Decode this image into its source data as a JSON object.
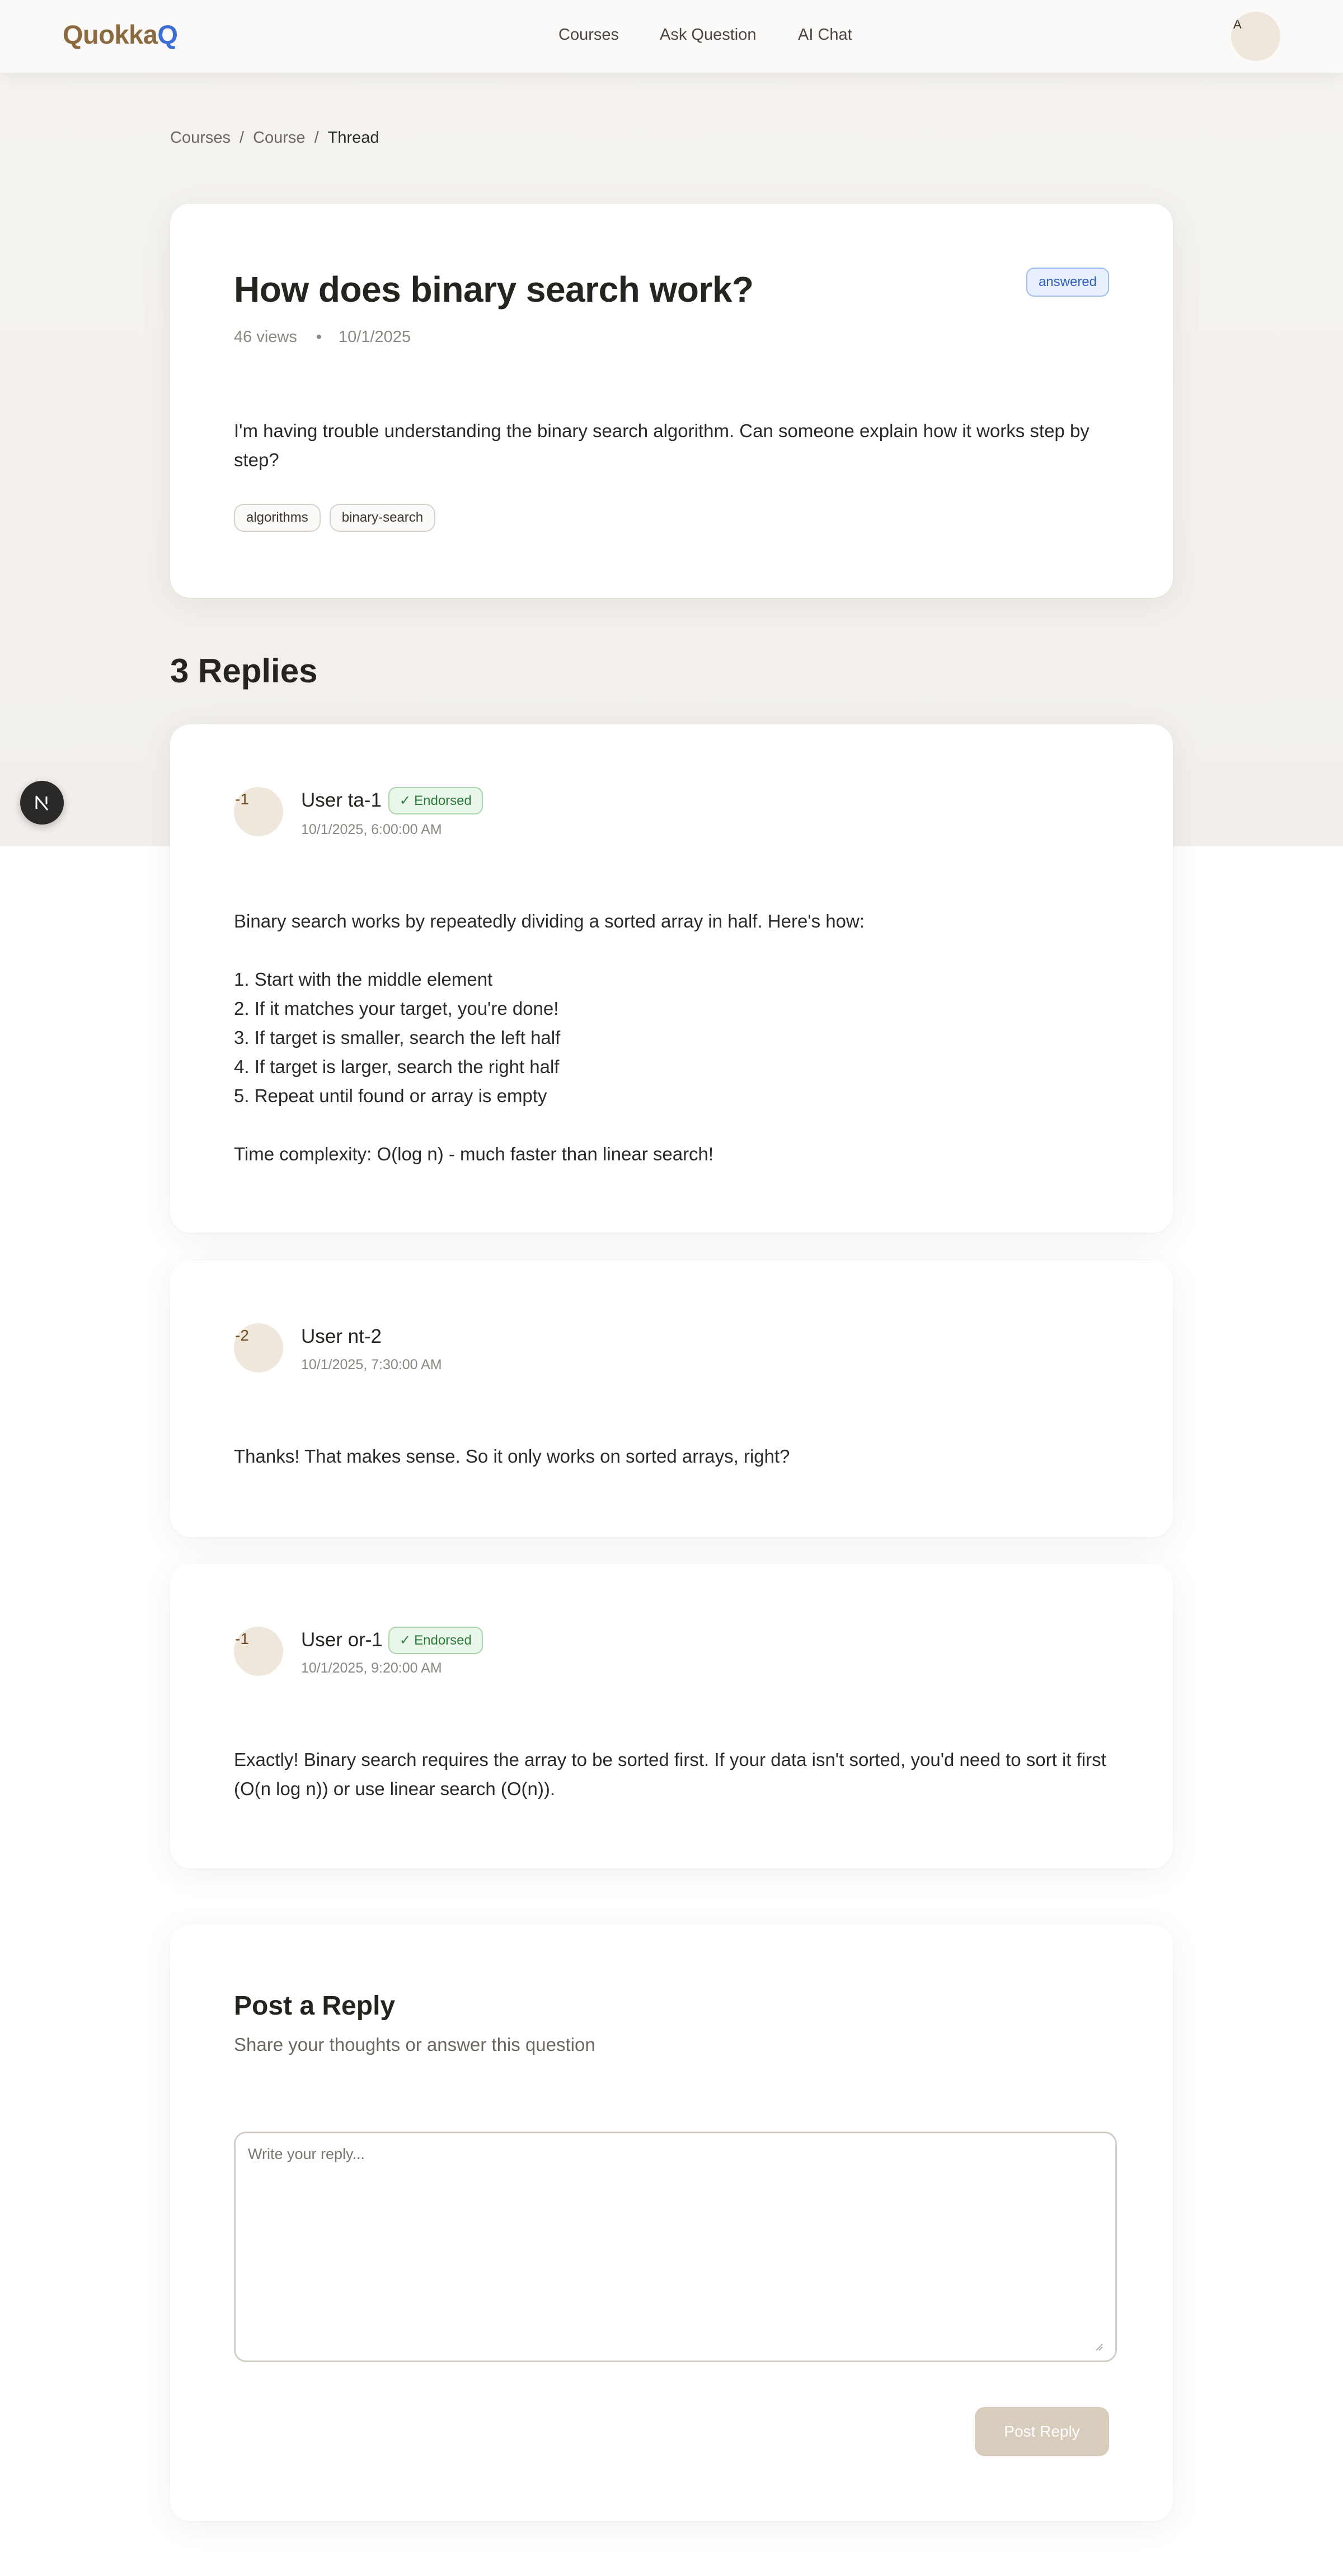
{
  "app": {
    "logo_part1": "Quokka",
    "logo_part2": "Q"
  },
  "nav": {
    "links": [
      "Courses",
      "Ask Question",
      "AI Chat"
    ],
    "avatar_initial": "A"
  },
  "breadcrumb": {
    "items": [
      "Courses",
      "Course",
      "Thread"
    ],
    "separator": "/"
  },
  "question": {
    "title": "How does binary search work?",
    "status": "answered",
    "views": "46 views",
    "date": "10/1/2025",
    "meta_dot": "•",
    "body": "I'm having trouble understanding the binary search algorithm. Can someone explain how it works step by step?",
    "tags": [
      "algorithms",
      "binary-search"
    ]
  },
  "replies_heading": "3 Replies",
  "replies": [
    {
      "avatar_text": "-1",
      "user": "User ta-1",
      "endorsed": true,
      "endorsed_label": "Endorsed",
      "timestamp": "10/1/2025, 6:00:00 AM",
      "body": "Binary search works by repeatedly dividing a sorted array in half. Here's how:\n\n1. Start with the middle element\n2. If it matches your target, you're done!\n3. If target is smaller, search the left half\n4. If target is larger, search the right half\n5. Repeat until found or array is empty\n\nTime complexity: O(log n) - much faster than linear search!"
    },
    {
      "avatar_text": "-2",
      "user": "User nt-2",
      "endorsed": false,
      "endorsed_label": "",
      "timestamp": "10/1/2025, 7:30:00 AM",
      "body": "Thanks! That makes sense. So it only works on sorted arrays, right?"
    },
    {
      "avatar_text": "-1",
      "user": "User or-1",
      "endorsed": true,
      "endorsed_label": "Endorsed",
      "timestamp": "10/1/2025, 9:20:00 AM",
      "body": "Exactly! Binary search requires the array to be sorted first. If your data isn't sorted, you'd need to sort it first (O(n log n)) or use linear search (O(n))."
    }
  ],
  "post_reply": {
    "title": "Post a Reply",
    "subtitle": "Share your thoughts or answer this question",
    "placeholder": "Write your reply...",
    "value": "",
    "button_label": "Post Reply"
  },
  "icons": {
    "check": "check-icon",
    "fab": "next-logo-icon"
  },
  "colors": {
    "brand_primary": "#8a6a3e",
    "brand_accent": "#3b6fd4",
    "endorsed_green": "#2d7a3a",
    "answered_blue": "#2f5fbf",
    "button_disabled": "#d8cdbd"
  }
}
